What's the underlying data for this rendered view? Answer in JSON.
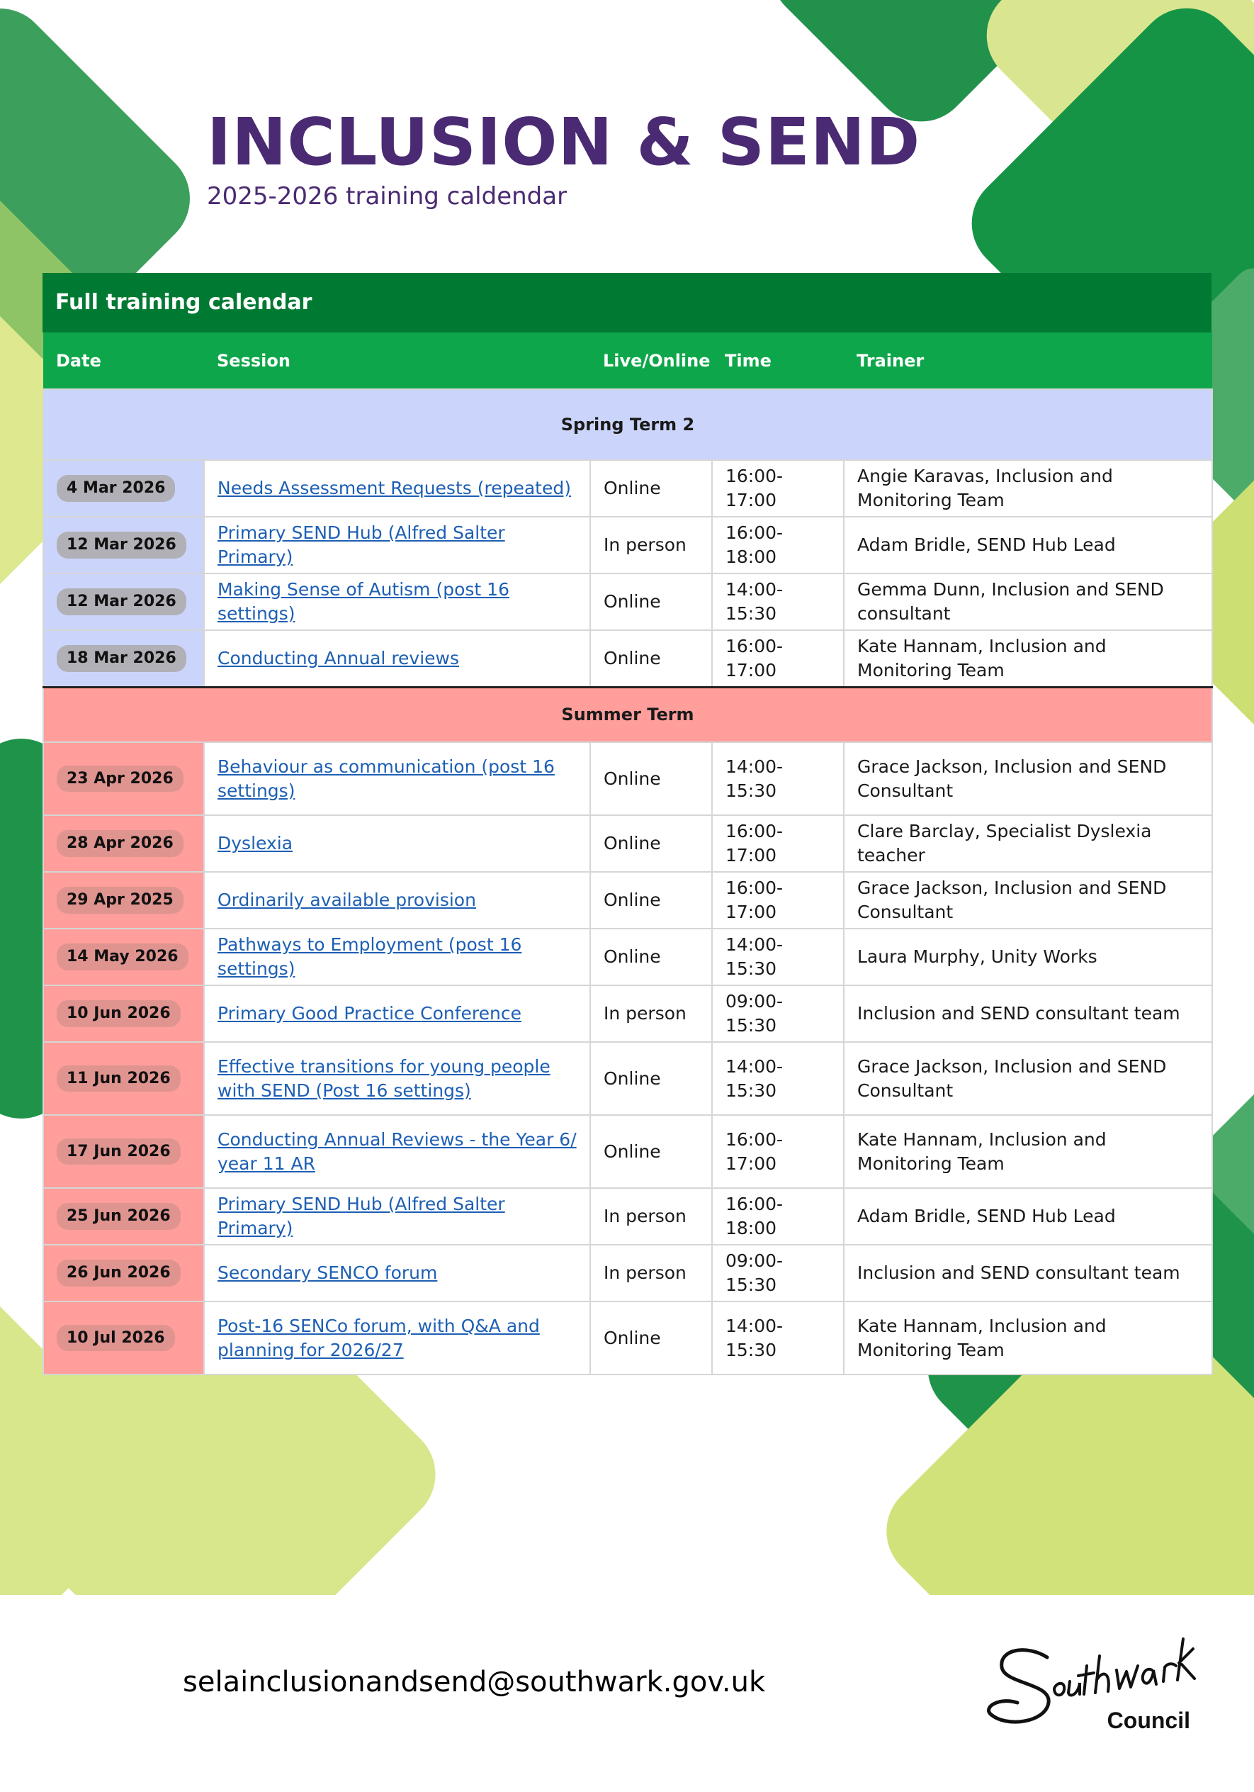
{
  "header": {
    "title": "INCLUSION & SEND",
    "subtitle": "2025-2026 training caldendar"
  },
  "table": {
    "heading": "Full training calendar",
    "columns": [
      "Date",
      "Session",
      "Live/Online",
      "Time",
      "Trainer"
    ],
    "terms": [
      {
        "name": "Spring Term 2",
        "rows": [
          {
            "date": "4 Mar 2026",
            "session": "Needs Assessment Requests (repeated)",
            "mode": "Online",
            "time": "16:00-17:00",
            "trainer": "Angie Karavas, Inclusion and Monitoring Team"
          },
          {
            "date": "12 Mar 2026",
            "session": "Primary SEND Hub (Alfred Salter Primary)",
            "mode": "In person",
            "time": "16:00-18:00",
            "trainer": "Adam Bridle, SEND Hub Lead"
          },
          {
            "date": "12 Mar 2026",
            "session": "Making Sense of Autism (post 16 settings)",
            "mode": "Online",
            "time": "14:00-15:30",
            "trainer": "Gemma Dunn, Inclusion and SEND consultant"
          },
          {
            "date": "18 Mar 2026",
            "session": "Conducting Annual reviews",
            "mode": "Online",
            "time": "16:00-17:00",
            "trainer": "Kate Hannam, Inclusion and Monitoring Team"
          }
        ]
      },
      {
        "name": "Summer Term",
        "rows": [
          {
            "date": "23 Apr 2026",
            "session": "Behaviour as communication (post 16 settings)",
            "mode": "Online",
            "time": "14:00-15:30",
            "trainer": "Grace Jackson, Inclusion and SEND Consultant"
          },
          {
            "date": "28 Apr 2026",
            "session": "Dyslexia",
            "mode": "Online",
            "time": "16:00-17:00",
            "trainer": "Clare Barclay, Specialist Dyslexia teacher"
          },
          {
            "date": "29 Apr 2025",
            "session": "Ordinarily available provision",
            "mode": "Online",
            "time": "16:00-17:00",
            "trainer": "Grace Jackson, Inclusion and SEND Consultant"
          },
          {
            "date": "14 May 2026",
            "session": "Pathways to Employment (post 16 settings)",
            "mode": "Online",
            "time": "14:00-15:30",
            "trainer": "Laura Murphy, Unity Works"
          },
          {
            "date": "10 Jun 2026",
            "session": "Primary Good Practice Conference",
            "mode": "In person",
            "time": "09:00-15:30",
            "trainer": "Inclusion and SEND consultant team"
          },
          {
            "date": "11 Jun 2026",
            "session": "Effective transitions for young people with SEND (Post 16 settings)",
            "mode": "Online",
            "time": "14:00-15:30",
            "trainer": "Grace Jackson, Inclusion and SEND Consultant"
          },
          {
            "date": "17 Jun 2026",
            "session": "Conducting Annual Reviews - the Year 6/ year 11 AR",
            "mode": "Online",
            "time": "16:00-17:00",
            "trainer": "Kate Hannam, Inclusion and Monitoring Team"
          },
          {
            "date": "25 Jun 2026",
            "session": "Primary SEND Hub (Alfred Salter Primary)",
            "mode": "In person",
            "time": "16:00-18:00",
            "trainer": "Adam Bridle, SEND Hub Lead"
          },
          {
            "date": "26 Jun 2026",
            "session": "Secondary SENCO forum",
            "mode": "In person",
            "time": "09:00-15:30",
            "trainer": "Inclusion and SEND consultant team"
          },
          {
            "date": "10 Jul 2026",
            "session": "Post-16 SENCo forum, with Q&A and planning for 2026/27",
            "mode": "Online",
            "time": "14:00-15:30",
            "trainer": "Kate Hannam, Inclusion and Monitoring Team"
          }
        ]
      }
    ]
  },
  "footer": {
    "email": "selainclusionandsend@southwark.gov.uk",
    "logo_script": "Southwark",
    "logo_sub": "Council"
  },
  "colors": {
    "title": "#4a2a72",
    "heading_bar": "#007a33",
    "column_bar": "#0ea64a",
    "spring": "#cbd5fb",
    "summer": "#ff9e9a",
    "link": "#1d5fb4"
  }
}
